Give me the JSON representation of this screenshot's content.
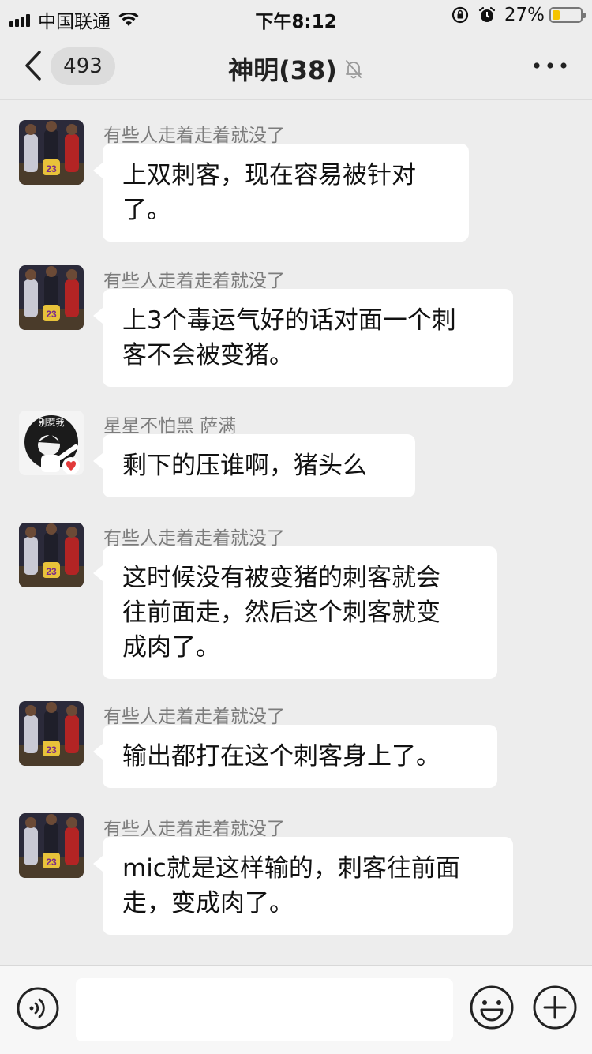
{
  "status": {
    "carrier": "中国联通",
    "time": "下午8:12",
    "battery_percent": "27%",
    "battery_level": 0.27,
    "battery_color": "#f5c400"
  },
  "header": {
    "back_icon": "chevron-left-icon",
    "unread_count": "493",
    "title": "神明(38)",
    "mute_icon": "bell-muted-icon",
    "more_icon": "more-horizontal-icon"
  },
  "messages": [
    {
      "sender": "有些人走着走着就没了",
      "avatar": "basketball-players-avatar",
      "lines": [
        "上双刺客，现在容易被针对",
        "了。"
      ]
    },
    {
      "sender": "有些人走着走着就没了",
      "avatar": "basketball-players-avatar",
      "lines": [
        "上3个毒运气好的话对面一个刺",
        "客不会被变猪。"
      ]
    },
    {
      "sender": "星星不怕黑 萨满",
      "avatar": "cartoon-dab-avatar",
      "avatar_text": "别惹我",
      "lines": [
        "剩下的压谁啊，猪头么"
      ]
    },
    {
      "sender": "有些人走着走着就没了",
      "avatar": "basketball-players-avatar",
      "lines": [
        "这时候没有被变猪的刺客就会",
        "往前面走，然后这个刺客就变",
        "成肉了。"
      ]
    },
    {
      "sender": "有些人走着走着就没了",
      "avatar": "basketball-players-avatar",
      "lines": [
        "输出都打在这个刺客身上了。"
      ]
    },
    {
      "sender": "有些人走着走着就没了",
      "avatar": "basketball-players-avatar",
      "lines": [
        "mic就是这样输的，刺客往前面",
        "走，变成肉了。"
      ]
    }
  ],
  "input_bar": {
    "voice_icon": "voice-icon",
    "input_value": "",
    "emoji_icon": "emoji-icon",
    "plus_icon": "plus-circle-icon"
  }
}
